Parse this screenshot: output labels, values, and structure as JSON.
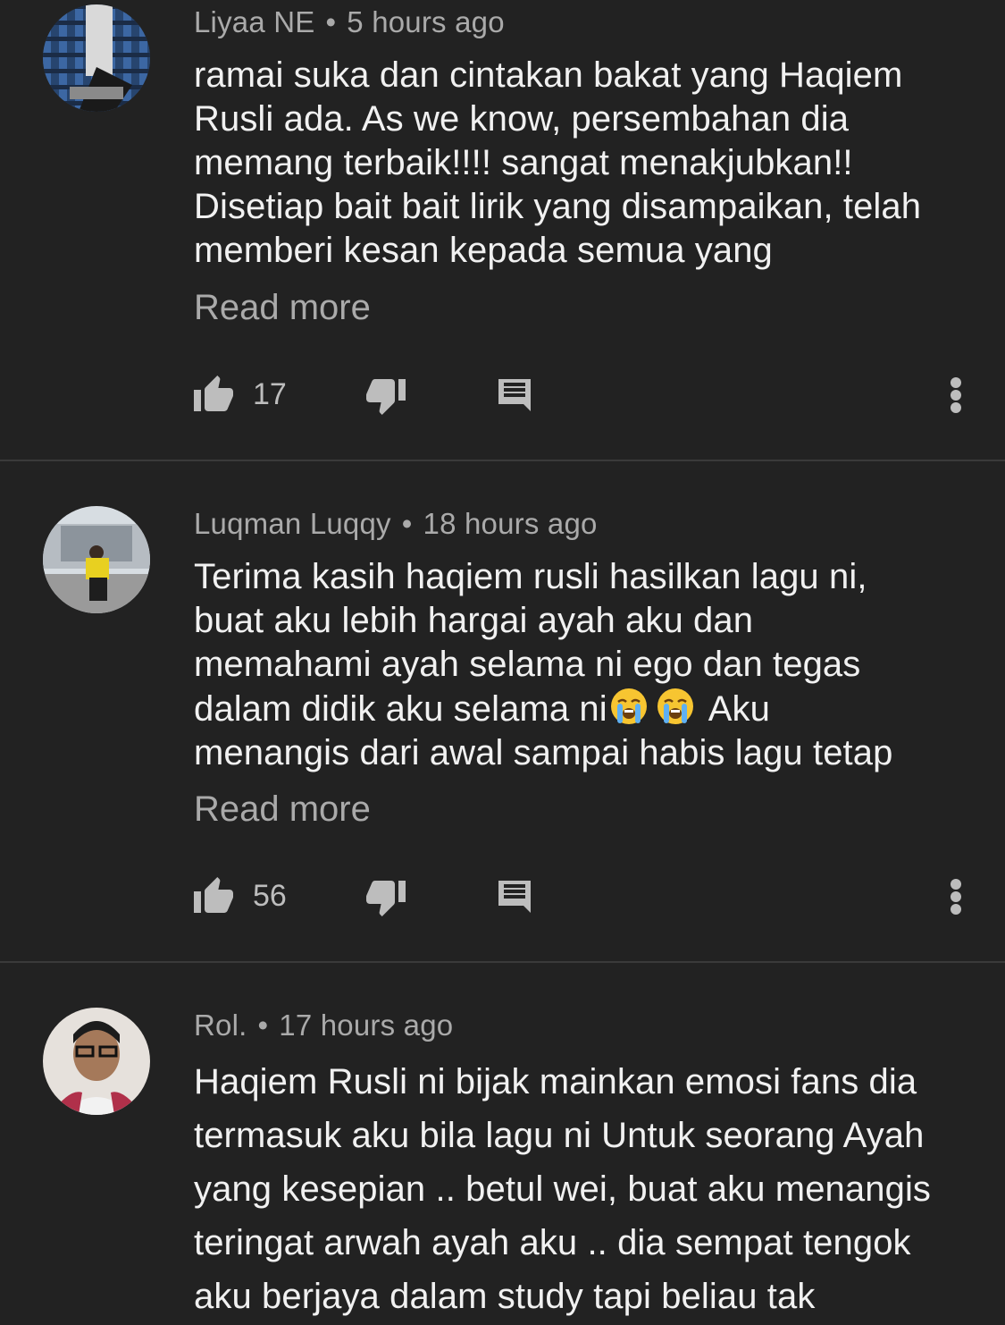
{
  "comments": [
    {
      "author": "Liyaa NE",
      "time": "5 hours ago",
      "lines": [
        "ramai suka dan cintakan bakat yang Haqiem",
        "Rusli ada. As we know,  persembahan dia",
        "memang terbaik!!!! sangat menakjubkan!!",
        "Disetiap bait bait lirik yang disampaikan, telah",
        "memberi kesan kepada semua yang"
      ],
      "read_more": "Read more",
      "likes": "17"
    },
    {
      "author": "Luqman Luqqy",
      "time": "18 hours ago",
      "lines": [
        "Terima kasih haqiem rusli hasilkan lagu ni,",
        "buat aku lebih hargai ayah aku dan",
        "memahami ayah selama ni ego dan tegas",
        "dalam didik aku selama ni",
        "menangis dari awal sampai habis lagu tetap"
      ],
      "line4_suffix": "Aku",
      "emoji": "crying-face",
      "read_more": "Read more",
      "likes": "56"
    },
    {
      "author": "Rol.",
      "time": "17 hours ago",
      "lines": [
        "Haqiem Rusli ni bijak mainkan emosi fans dia",
        "termasuk aku bila lagu ni Untuk seorang Ayah",
        "yang kesepian .. betul wei, buat aku menangis",
        "teringat arwah ayah aku .. dia sempat tengok",
        "aku berjaya dalam study tapi beliau tak"
      ]
    }
  ],
  "separator": "•",
  "colors": {
    "background": "#222222",
    "text": "#f1f1f1",
    "secondary": "#aaaaaa",
    "divider": "#3a3a3a"
  },
  "icons": [
    "thumbs-up-icon",
    "thumbs-down-icon",
    "reply-icon",
    "more-vert-icon",
    "crying-face-emoji"
  ]
}
